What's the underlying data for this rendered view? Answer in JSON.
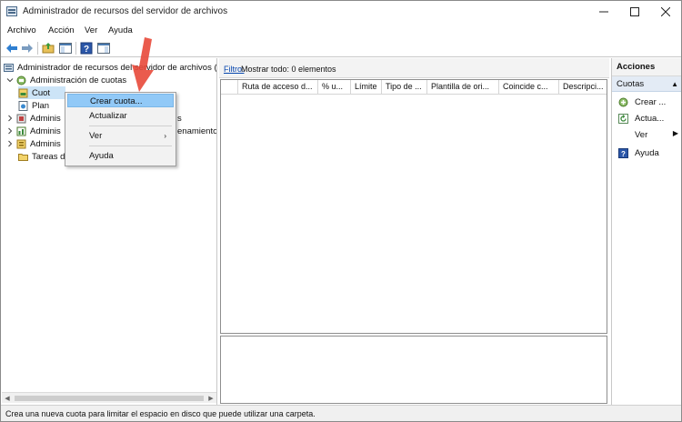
{
  "window": {
    "title": "Administrador de recursos del servidor de archivos"
  },
  "menu": {
    "items": [
      "Archivo",
      "Acción",
      "Ver",
      "Ayuda"
    ]
  },
  "toolbar": {
    "icons": [
      "back-arrow-icon",
      "forward-arrow-icon",
      "folder-up-icon",
      "console-tree-icon",
      "help-icon",
      "properties-icon"
    ]
  },
  "tree": {
    "root_label": "Administrador de recursos del servidor de archivos (lo",
    "items": [
      {
        "label": "Administración de cuotas"
      },
      {
        "label": "Cuot"
      },
      {
        "label": "Plan"
      },
      {
        "label": "Adminis"
      },
      {
        "label": "Adminis"
      },
      {
        "label": "Adminis"
      },
      {
        "label": "Tareas d"
      }
    ],
    "partial_right_texts": [
      "s",
      "enamiento"
    ]
  },
  "context_menu": {
    "items": [
      "Crear cuota...",
      "Actualizar",
      "Ver",
      "Ayuda"
    ]
  },
  "middle": {
    "filter_link": "Filtro:",
    "filter_text": "Mostrar todo: 0 elementos",
    "columns": [
      "Ruta de acceso d...",
      "% u...",
      "Límite",
      "Tipo de ...",
      "Plantilla de ori...",
      "Coincide c...",
      "Descripci..."
    ]
  },
  "actions": {
    "header": "Acciones",
    "section": "Cuotas",
    "items": [
      "Crear ...",
      "Actua...",
      "Ver",
      "Ayuda"
    ]
  },
  "statusbar": {
    "text": "Crea una nueva cuota para limitar el espacio en disco que puede utilizar una carpeta."
  },
  "colors": {
    "selection_blue": "#cce4f7",
    "menu_highlight": "#91c9f7",
    "actions_section_bg": "#e3ebf5",
    "link_blue": "#0645ad",
    "annotation_arrow": "#e8493a"
  }
}
